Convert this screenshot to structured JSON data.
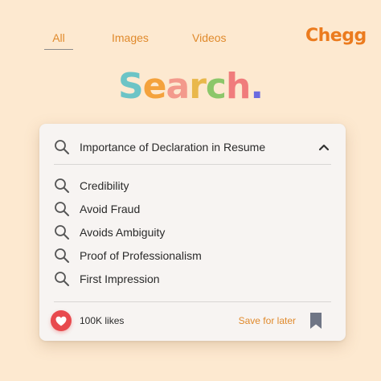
{
  "tabs": [
    {
      "label": "All",
      "active": true
    },
    {
      "label": "Images",
      "active": false
    },
    {
      "label": "Videos",
      "active": false
    }
  ],
  "brand": {
    "logo_text": "Chegg",
    "color": "#eb7b1e"
  },
  "hero": {
    "letters": [
      {
        "ch": "S",
        "color": "#6cc4c6"
      },
      {
        "ch": "e",
        "color": "#f4a23c"
      },
      {
        "ch": "a",
        "color": "#f39a8c"
      },
      {
        "ch": "r",
        "color": "#e9b84c"
      },
      {
        "ch": "c",
        "color": "#8cc76a"
      },
      {
        "ch": "h",
        "color": "#f07c7c"
      },
      {
        "ch": ".",
        "color": "#6a6ae0"
      }
    ]
  },
  "search": {
    "query": "Importance of Declaration in Resume",
    "icon": "search-icon",
    "expand_icon": "chevron-up-icon",
    "suggestions": [
      "Credibility",
      "Avoid Fraud",
      "Avoids Ambiguity",
      "Proof of Professionalism",
      "First Impression"
    ]
  },
  "footer": {
    "likes": "100K likes",
    "like_icon": "heart-icon",
    "like_color": "#e84a4e",
    "save_label": "Save for later",
    "bookmark_icon": "bookmark-icon",
    "accent": "#e08a2c"
  }
}
